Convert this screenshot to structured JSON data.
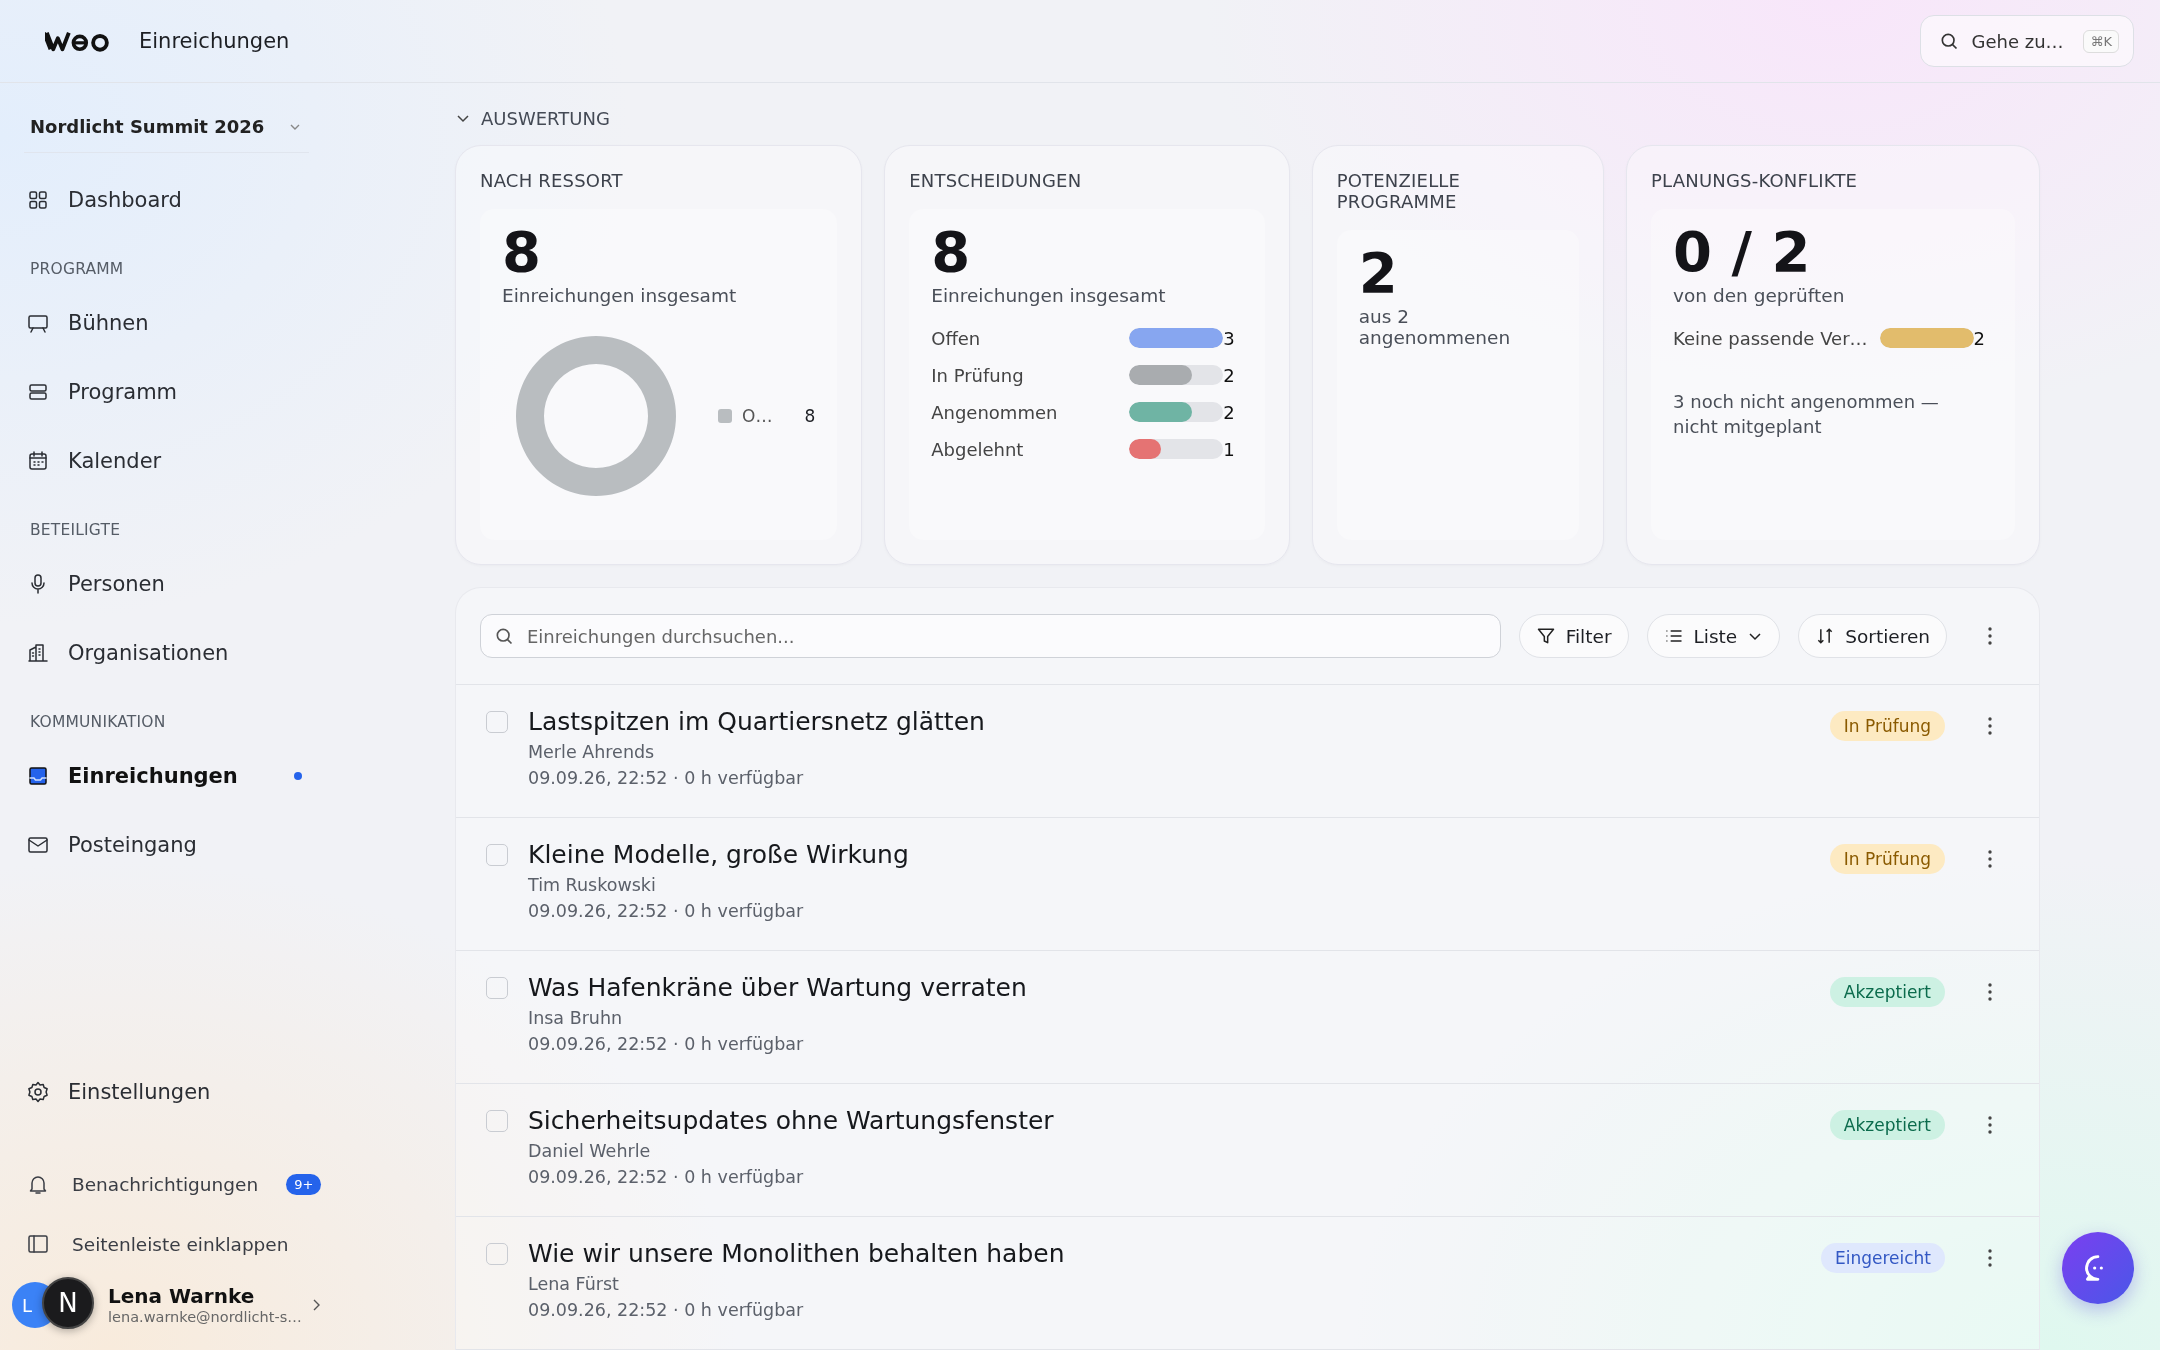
{
  "header": {
    "title": "Einreichungen",
    "search_placeholder": "Gehe zu…",
    "shortcut": "⌘K"
  },
  "sidebar": {
    "event": "Nordlicht Summit 2026",
    "sections": [
      {
        "items": [
          {
            "label": "Dashboard",
            "selected": false,
            "dot": false
          }
        ]
      },
      {
        "title": "PROGRAMM",
        "items": [
          {
            "label": "Bühnen",
            "selected": false,
            "dot": false
          },
          {
            "label": "Programm",
            "selected": false,
            "dot": false
          },
          {
            "label": "Kalender",
            "selected": false,
            "dot": false
          }
        ]
      },
      {
        "title": "BETEILIGTE",
        "items": [
          {
            "label": "Personen",
            "selected": false,
            "dot": false
          },
          {
            "label": "Organisationen",
            "selected": false,
            "dot": false
          }
        ]
      },
      {
        "title": "KOMMUNIKATION",
        "items": [
          {
            "label": "Einreichungen",
            "selected": true,
            "dot": true
          },
          {
            "label": "Posteingang",
            "selected": false,
            "dot": false
          }
        ]
      }
    ],
    "settings": "Einstellungen",
    "notifications": {
      "label": "Benachrichtigungen",
      "badge": "9+"
    },
    "collapse": "Seitenleiste einklappen",
    "user": {
      "initials": "L",
      "name": "Lena Warnke",
      "email": "lena.warnke@nordlicht-s…"
    },
    "dev_badge": "N"
  },
  "section_title": "AUSWERTUNG",
  "cards": [
    {
      "kind": "donut",
      "title": "NACH RESSORT",
      "value": "8",
      "caption": "Einreichungen insgesamt",
      "legend": [
        {
          "label": "O…",
          "count": "8",
          "color": "#b9bdc0"
        }
      ]
    },
    {
      "kind": "bars",
      "title": "ENTSCHEIDUNGEN",
      "value": "8",
      "caption": "Einreichungen insgesamt",
      "bars": [
        {
          "label": "Offen",
          "count": "3",
          "level": 1,
          "color": "#87a6f0"
        },
        {
          "label": "In Prüfung",
          "count": "2",
          "level": 0.67,
          "color": "#a9acaf"
        },
        {
          "label": "Angenommen",
          "count": "2",
          "level": 0.67,
          "color": "#6fb4a4"
        },
        {
          "label": "Abgelehnt",
          "count": "1",
          "level": 0.34,
          "color": "#e57373"
        }
      ]
    },
    {
      "kind": "plain",
      "title": "POTENZIELLE PROGRAMME",
      "value": "2",
      "caption": "aus 2 angenommenen"
    },
    {
      "kind": "bars",
      "title": "PLANUNGS-KONFLIKTE",
      "value": "0 / 2",
      "caption": "von den geprüften",
      "bars": [
        {
          "label": "Keine passende Ver…",
          "count": "2",
          "level": 1,
          "color": "#e2bc6c"
        }
      ],
      "note": "3 noch nicht angenommen — nicht mitgeplant"
    }
  ],
  "toolbar": {
    "search_placeholder": "Einreichungen durchsuchen...",
    "filter": "Filter",
    "view": "Liste",
    "sort": "Sortieren"
  },
  "submissions": [
    {
      "title": "Lastspitzen im Quartiersnetz glätten",
      "author": "Merle Ahrends",
      "meta": "09.09.26, 22:52 · 0 h verfügbar",
      "checked": false,
      "status": {
        "label": "In Prüfung",
        "kind": "review"
      }
    },
    {
      "title": "Kleine Modelle, große Wirkung",
      "author": "Tim Ruskowski",
      "meta": "09.09.26, 22:52 · 0 h verfügbar",
      "checked": false,
      "status": {
        "label": "In Prüfung",
        "kind": "review"
      }
    },
    {
      "title": "Was Hafenkräne über Wartung verraten",
      "author": "Insa Bruhn",
      "meta": "09.09.26, 22:52 · 0 h verfügbar",
      "checked": false,
      "status": {
        "label": "Akzeptiert",
        "kind": "accepted"
      }
    },
    {
      "title": "Sicherheitsupdates ohne Wartungsfenster",
      "author": "Daniel Wehrle",
      "meta": "09.09.26, 22:52 · 0 h verfügbar",
      "checked": false,
      "status": {
        "label": "Akzeptiert",
        "kind": "accepted"
      }
    },
    {
      "title": "Wie wir unsere Monolithen behalten haben",
      "author": "Lena Fürst",
      "meta": "09.09.26, 22:52 · 0 h verfügbar",
      "checked": false,
      "status": {
        "label": "Eingereicht",
        "kind": "submitted"
      }
    }
  ]
}
